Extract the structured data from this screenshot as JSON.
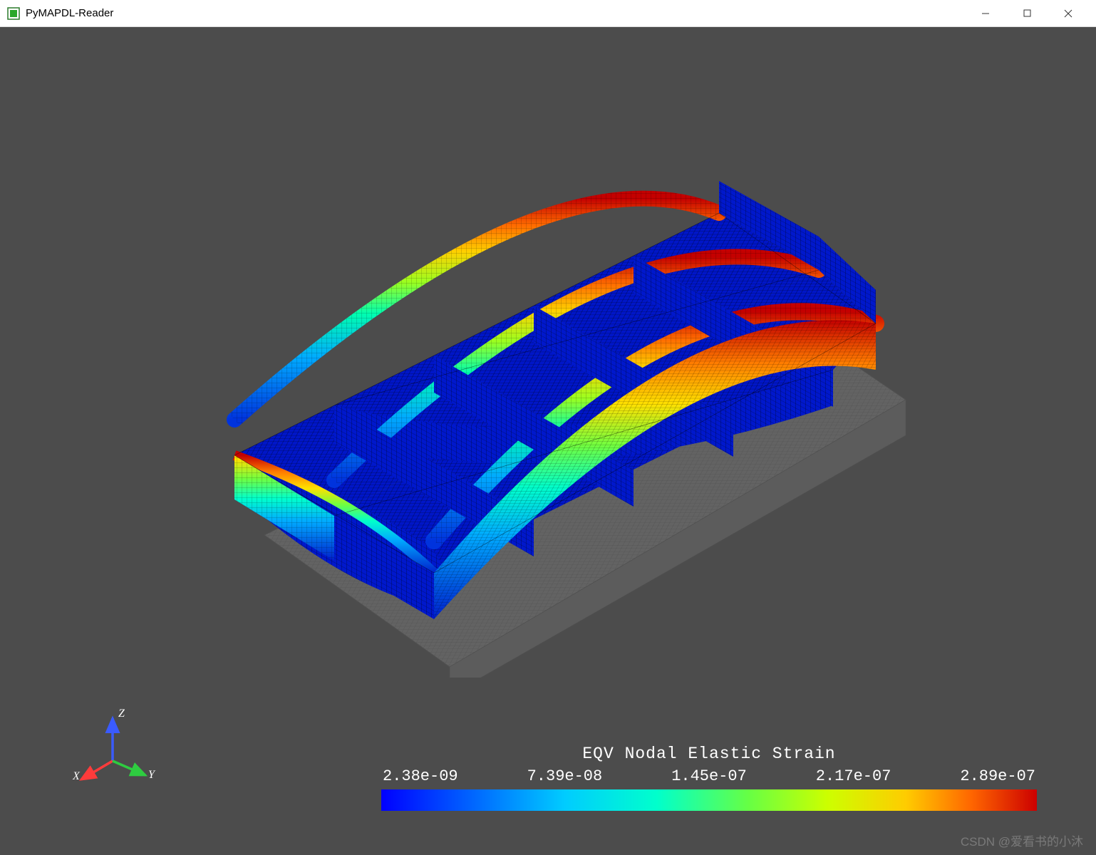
{
  "window": {
    "title": "PyMAPDL-Reader"
  },
  "axes": {
    "x": "X",
    "y": "Y",
    "z": "Z"
  },
  "colorbar": {
    "title": "EQV Nodal Elastic Strain",
    "ticks": [
      "2.38e-09",
      "7.39e-08",
      "1.45e-07",
      "2.17e-07",
      "2.89e-07"
    ]
  },
  "colors": {
    "viewport_bg": "#4c4c4c",
    "axis_x": "#ff3333",
    "axis_y": "#33cc33",
    "axis_z": "#3355ff"
  },
  "watermark": "CSDN @爱看书的小沐"
}
